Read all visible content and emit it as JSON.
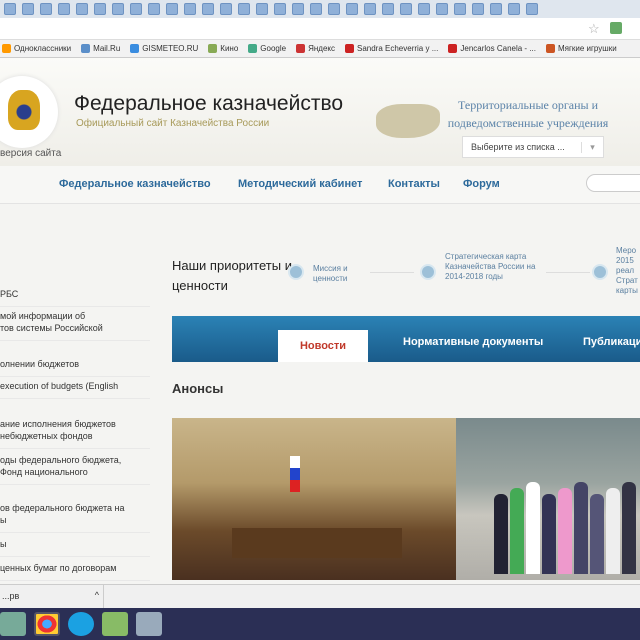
{
  "browser": {
    "bookmarks": [
      "Одноклассники",
      "Mail.Ru",
      "GISMETEO.RU",
      "Кино",
      "Google",
      "Яндекс",
      "Sandra Echeverria y ...",
      "Jencarlos Canela - ...",
      "Мягкие игрушки"
    ]
  },
  "header": {
    "title": "Федеральное казначейство",
    "subtitle": "Официальный сайт Казначейства России",
    "version_link": "версия сайта",
    "territorial_line1": "Территориальные органы и",
    "territorial_line2": "подведомственные учреждения",
    "select_value": "Выберите из списка ...",
    "select_arrow": "▾"
  },
  "nav": [
    "Федеральное казначейство",
    "Методический кабинет",
    "Контакты",
    "Форум"
  ],
  "sidebar": [
    "РБС",
    "мой информации об\nтов системы Российской",
    "олнении бюджетов",
    "execution of budgets (English",
    "ание исполнения бюджетов\nнебюджетных фондов",
    "оды федерального бюджета,\nФонд национального",
    "ов федерального бюджета на\nы",
    "ы",
    "ценных бумаг по договорам"
  ],
  "priorities": {
    "title": "Наши приоритеты и ценности",
    "items": [
      "Миссия и ценности",
      "Стратегическая карта Казначейства России на 2014-2018 годы",
      "Меро 2015 реал Страт карты"
    ]
  },
  "tabs": {
    "active": "Новости",
    "items": [
      "Нормативные документы",
      "Публикации"
    ]
  },
  "anons": "Анонсы",
  "download": {
    "file": "...рв",
    "arrow": "^"
  }
}
